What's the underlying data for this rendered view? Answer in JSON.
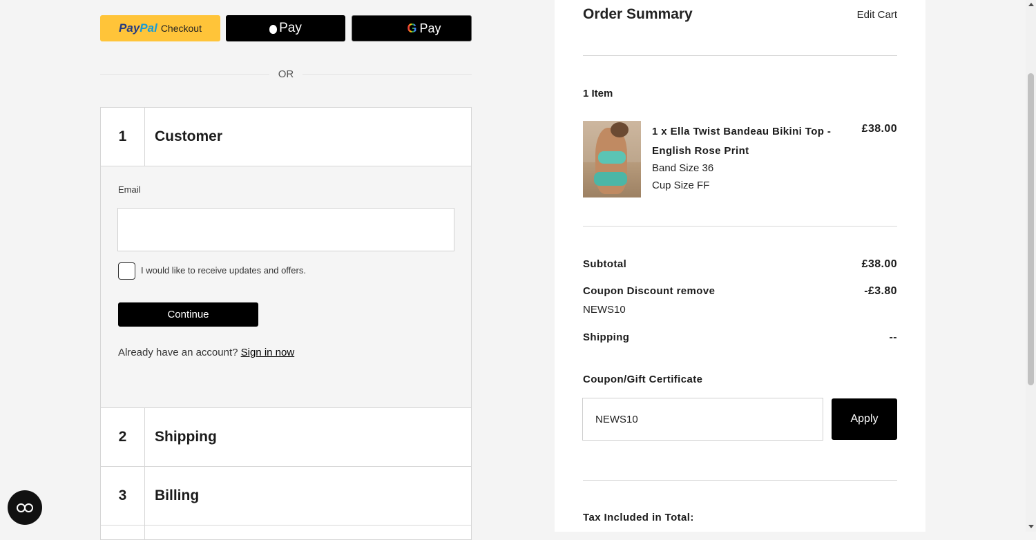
{
  "express_pay": {
    "paypal_word1": "Pay",
    "paypal_word2": "Pal",
    "paypal_checkout": "Checkout",
    "apple_pay_label": "Pay",
    "google_g": "G",
    "google_pay_label": "Pay"
  },
  "or_divider": "OR",
  "steps": [
    {
      "number": "1",
      "title": "Customer"
    },
    {
      "number": "2",
      "title": "Shipping"
    },
    {
      "number": "3",
      "title": "Billing"
    }
  ],
  "customer": {
    "email_label": "Email",
    "email_value": "",
    "newsletter_label": "I would like to receive updates and offers.",
    "continue_label": "Continue",
    "account_prompt": "Already have an account?",
    "sign_in_link": "Sign in now"
  },
  "summary": {
    "title": "Order Summary",
    "edit_cart": "Edit Cart",
    "items_count": "1 Item",
    "item": {
      "name": "1 x Ella Twist Bandeau Bikini Top - English Rose Print",
      "price": "£38.00",
      "band_size": "Band Size 36",
      "cup_size": "Cup Size FF"
    },
    "subtotal_label": "Subtotal",
    "subtotal_value": "£38.00",
    "coupon_label": "Coupon Discount",
    "coupon_remove": "remove",
    "coupon_value": "-£3.80",
    "coupon_code": "NEWS10",
    "shipping_label": "Shipping",
    "shipping_value": "--",
    "coupon_field_label": "Coupon/Gift Certificate",
    "coupon_input_value": "NEWS10",
    "apply_label": "Apply",
    "tax_label": "Tax Included in Total:"
  }
}
